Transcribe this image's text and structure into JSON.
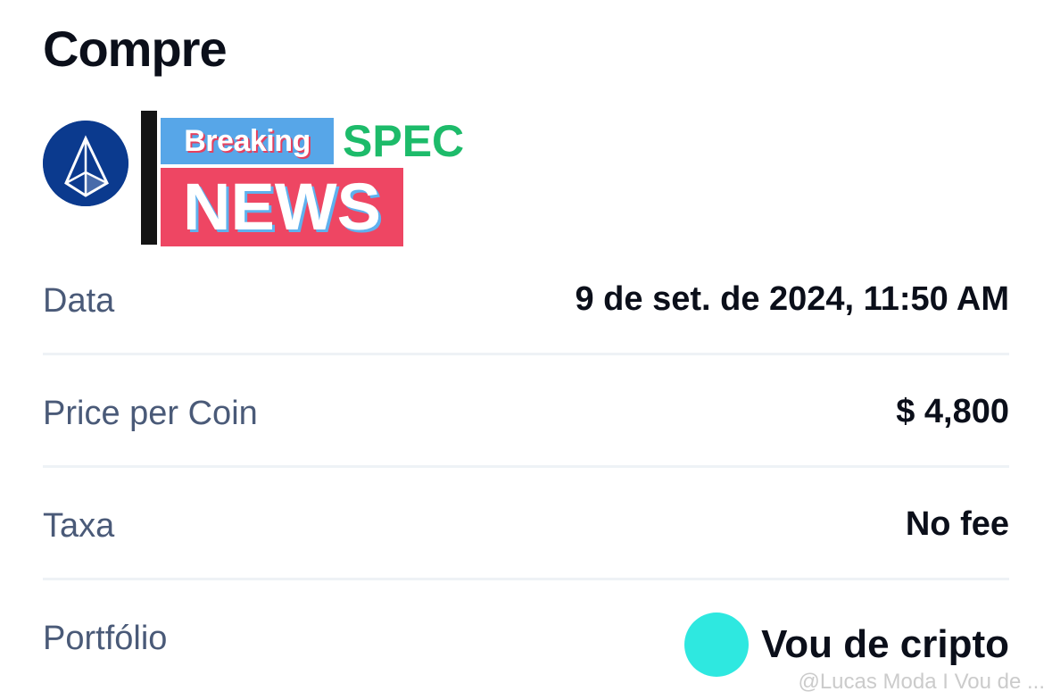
{
  "header": {
    "title": "Compre"
  },
  "coin": {
    "logo_icon": "triangle-prism-icon",
    "logo_color": "#0b3a8e"
  },
  "news_sticker": {
    "breaking": "Breaking",
    "spec": "SPEC",
    "news": "NEWS"
  },
  "details": {
    "date_label": "Data",
    "date_value": "9 de set. de 2024, 11:50 AM",
    "price_label": "Price per Coin",
    "price_value": "$ 4,800",
    "fee_label": "Taxa",
    "fee_value": "No fee",
    "portfolio_label": "Portfólio",
    "portfolio_value": "Vou de cripto",
    "portfolio_color": "#2ee8e0"
  },
  "watermark": "@Lucas Moda I Vou de ..."
}
